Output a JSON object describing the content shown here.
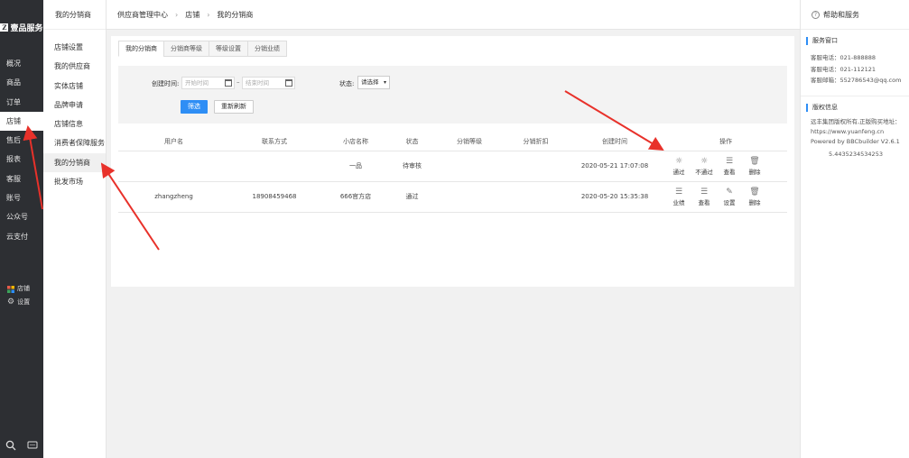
{
  "sidebar": {
    "logo": "壹品服务",
    "logo_mark": "Z",
    "items": [
      {
        "label": "概况"
      },
      {
        "label": "商品"
      },
      {
        "label": "订单"
      },
      {
        "label": "店铺"
      },
      {
        "label": "售后"
      },
      {
        "label": "报表"
      },
      {
        "label": "客服"
      },
      {
        "label": "账号"
      },
      {
        "label": "公众号"
      },
      {
        "label": "云支付"
      }
    ],
    "bottom": {
      "shop": "店铺",
      "settings": "设置"
    }
  },
  "submenu": {
    "title": "我的分销商",
    "items": [
      {
        "label": "店铺设置"
      },
      {
        "label": "我的供应商"
      },
      {
        "label": "实体店铺"
      },
      {
        "label": "品牌申请"
      },
      {
        "label": "店铺信息"
      },
      {
        "label": "消费者保障服务"
      },
      {
        "label": "我的分销商"
      },
      {
        "label": "批发市场"
      }
    ]
  },
  "breadcrumb": [
    "供应商管理中心",
    "店铺",
    "我的分销商"
  ],
  "tabs": [
    "我的分销商",
    "分销商等级",
    "等级设置",
    "分销业绩"
  ],
  "filter": {
    "created_label": "创建时间:",
    "start_placeholder": "开始时间",
    "end_placeholder": "结束时间",
    "dash": "–",
    "status_label": "状态:",
    "status_value": "请选择",
    "search_btn": "筛选",
    "reset_btn": "重新刷新"
  },
  "table": {
    "headers": [
      "用户名",
      "联系方式",
      "小店名称",
      "状态",
      "分销等级",
      "分销折扣",
      "创建时间",
      "操作"
    ],
    "rows": [
      {
        "user": "",
        "contact": "",
        "shop": "一品",
        "status": "待审核",
        "level": "",
        "discount": "",
        "created": "2020-05-21 17:07:08",
        "ops": [
          {
            "icon": "sun-icon",
            "label": "通过"
          },
          {
            "icon": "sun-icon",
            "label": "不通过"
          },
          {
            "icon": "list-icon",
            "label": "查看"
          },
          {
            "icon": "trash-icon",
            "label": "删除"
          }
        ]
      },
      {
        "user": "zhangzheng",
        "contact": "18908459468",
        "shop": "666官方店",
        "status": "通过",
        "level": "",
        "discount": "",
        "created": "2020-05-20 15:35:38",
        "ops": [
          {
            "icon": "list-icon",
            "label": "业绩"
          },
          {
            "icon": "list-icon",
            "label": "查看"
          },
          {
            "icon": "edit-icon",
            "label": "设置"
          },
          {
            "icon": "trash-icon",
            "label": "删除"
          }
        ]
      }
    ]
  },
  "help": {
    "title": "帮助和服务",
    "service_title": "服务窗口",
    "lines": [
      "客服电话：021-888888",
      "客服电话：021-112121",
      "客服邮箱：552786543@qq.com"
    ],
    "copyright_title": "版权信息",
    "copyright_text": "远丰集团版权所有,正版购买地址：https://www.yuanfeng.cn Powered by BBCbuilder V2.6.1",
    "version_code": "5.4435234534253"
  },
  "colors": {
    "primary": "#2e8ef5",
    "sidebar": "#2d2f33",
    "arrow": "#e8312a"
  }
}
